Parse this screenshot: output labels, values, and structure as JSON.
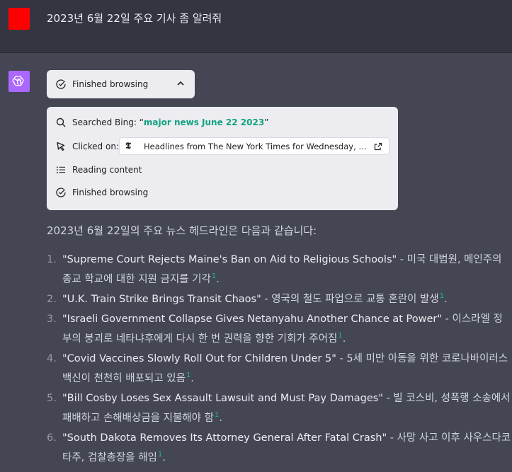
{
  "user": {
    "avatar_color": "#ff0000",
    "message": "2023년 6월 22일 주요 기사 좀 알려줘"
  },
  "assistant": {
    "avatar_icon": "openai-logo-icon",
    "avatar_color": "#ab68ff",
    "status_label": "Finished browsing",
    "browse_steps": {
      "searched_prefix": "Searched Bing: “",
      "searched_query": "major news June 22 2023",
      "searched_suffix": "”",
      "clicked_label": "Clicked on:",
      "clicked_link_text": "Headlines from The New York Times for Wednesday, June …",
      "reading_label": "Reading content",
      "finished_label": "Finished browsing"
    },
    "intro": "2023년 6월 22일의 주요 뉴스 헤드라인은 다음과 같습니다:",
    "news": [
      {
        "num": "1.",
        "headline": "\"Supreme Court Rejects Maine's Ban on Aid to Religious Schools\"",
        "desc": " - 미국 대법원, 메인주의 종교 학교에 대한 지원 금지를 기각",
        "cite": "1",
        "end": "."
      },
      {
        "num": "2.",
        "headline": "\"U.K. Train Strike Brings Transit Chaos\"",
        "desc": " - 영국의 철도 파업으로 교통 혼란이 발생",
        "cite": "1",
        "end": "."
      },
      {
        "num": "3.",
        "headline": "\"Israeli Government Collapse Gives Netanyahu Another Chance at Power\"",
        "desc": " - 이스라엘 정부의 붕괴로 네타냐후에게 다시 한 번 권력을 향한 기회가 주어짐",
        "cite": "1",
        "end": "."
      },
      {
        "num": "4.",
        "headline": "\"Covid Vaccines Slowly Roll Out for Children Under 5\"",
        "desc": " - 5세 미만 아동을 위한 코로나바이러스 백신이 천천히 배포되고 있음",
        "cite": "1",
        "end": "."
      },
      {
        "num": "5.",
        "headline": "\"Bill Cosby Loses Sex Assault Lawsuit and Must Pay Damages\"",
        "desc": " - 빌 코스비, 성폭행 소송에서 패배하고 손해배상금을 지불해야 함",
        "cite": "1",
        "end": "."
      },
      {
        "num": "6.",
        "headline": "\"South Dakota Removes Its Attorney General After Fatal Crash\"",
        "desc": " - 사망 사고 이후 사우스다코타주, 검찰총장을 해임",
        "cite": "1",
        "end": "."
      }
    ]
  },
  "colors": {
    "user_bg": "#343541",
    "assistant_bg": "#444654",
    "accent": "#10a37f"
  }
}
